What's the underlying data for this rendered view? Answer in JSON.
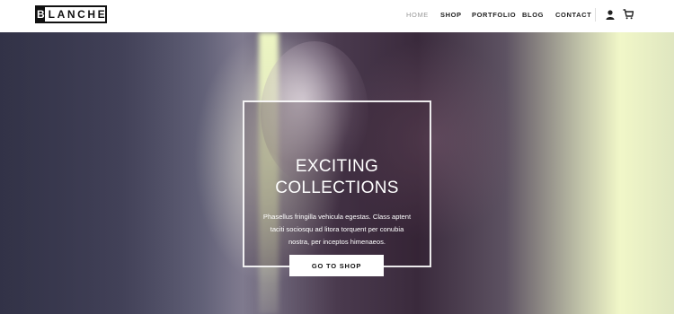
{
  "logo": {
    "initial": "B",
    "rest": "LANCHE"
  },
  "nav": {
    "items": [
      {
        "label": "HOME",
        "active": true
      },
      {
        "label": "SHOP",
        "active": false
      },
      {
        "label": "PORTFOLIO",
        "active": false
      },
      {
        "label": "BLOG",
        "active": false
      },
      {
        "label": "CONTACT",
        "active": false
      }
    ],
    "icons": [
      "user-icon",
      "cart-icon"
    ]
  },
  "hero": {
    "title_line1": "EXCITING",
    "title_line2": "COLLECTIONS",
    "text_line1": "Phasellus fringilla vehicula egestas. Class aptent",
    "text_line2": "taciti sociosqu ad litora torquent per conubia",
    "text_line3": "nostra, per inceptos himenaeos.",
    "button_label": "GO TO SHOP"
  },
  "colors": {
    "accent": "#111111",
    "nav_active": "#999999",
    "hero_text": "#ffffff"
  }
}
